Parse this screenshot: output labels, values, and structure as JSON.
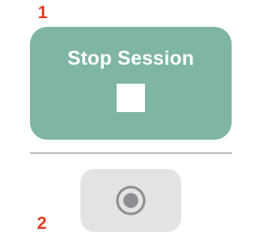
{
  "annotations": {
    "step_1": "1",
    "step_2": "2",
    "color": "#e03a1e"
  },
  "stop_session": {
    "label": "Stop Session",
    "icon": "stop-square-icon",
    "background": "#7fb5a5",
    "text_color": "#ffffff"
  },
  "divider": {
    "color": "#b7b7b7"
  },
  "record": {
    "icon": "record-icon",
    "background": "#e3e3e5",
    "icon_color": "#8e8e93"
  }
}
